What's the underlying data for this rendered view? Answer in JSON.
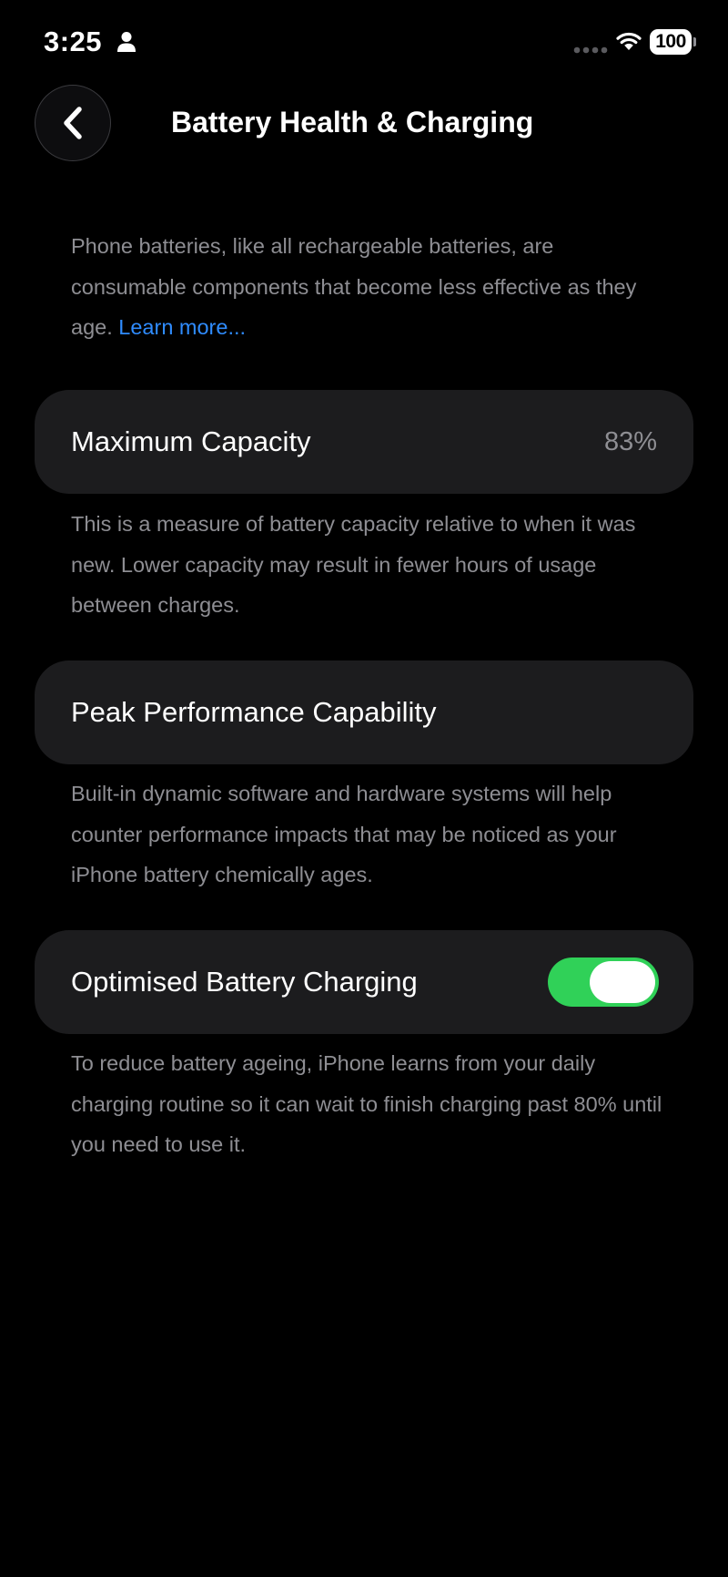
{
  "status_bar": {
    "time": "3:25",
    "battery_level": "100",
    "icons": [
      "person-icon",
      "signal-icon",
      "wifi-icon",
      "battery-icon"
    ]
  },
  "nav": {
    "back_icon": "chevron-left-icon",
    "title": "Battery Health & Charging"
  },
  "intro": {
    "text": "Phone batteries, like all rechargeable batteries, are consumable components that become less effective as they age. ",
    "link": "Learn more..."
  },
  "maximum_capacity": {
    "label": "Maximum Capacity",
    "value": "83%",
    "description": "This is a measure of battery capacity relative to when it was new. Lower capacity may result in fewer hours of usage between charges."
  },
  "peak_performance": {
    "label": "Peak Performance Capability",
    "description": "Built-in dynamic software and hardware systems will help counter performance impacts that may be noticed as your iPhone battery chemically ages."
  },
  "optimised_charging": {
    "label": "Optimised Battery Charging",
    "enabled": true,
    "description": "To reduce battery ageing, iPhone learns from your daily charging routine so it can wait to finish charging past 80% until you need to use it."
  },
  "colors": {
    "background": "#000000",
    "cell": "#1c1c1e",
    "secondary_text": "#8e8e93",
    "link": "#2f8cff",
    "toggle_on": "#30d158"
  }
}
